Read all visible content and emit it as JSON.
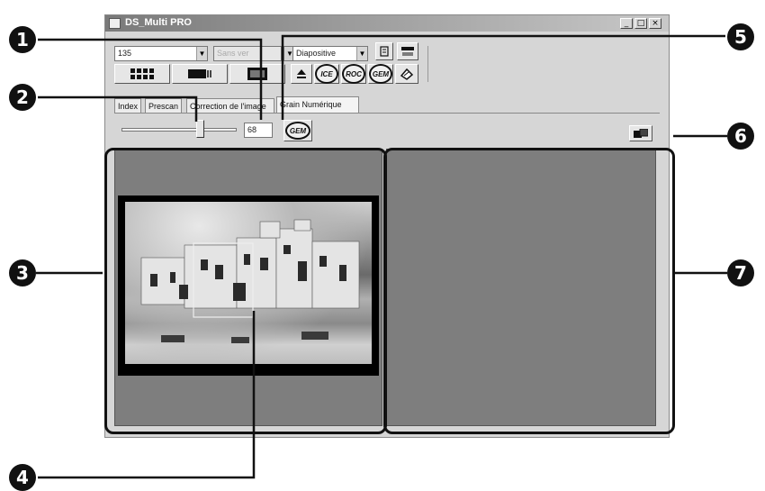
{
  "window": {
    "title": "DS_Multi PRO",
    "controls": [
      "_",
      "□",
      "×"
    ]
  },
  "toolbar": {
    "film_format": "135",
    "film_holder": "Sans ver",
    "film_type": "Diapositive",
    "dropdown_arrow": "▼",
    "row1_icons": [
      "eject-icon",
      "settings-icon"
    ],
    "row2_buttons": [
      "index-scan-icon",
      "prescan-icon",
      "scan-icon"
    ],
    "row2_icons": [
      "eject-icon",
      "ice-icon",
      "roc-icon",
      "gem-icon",
      "tool-icon"
    ],
    "ice_label": "ICE",
    "roc_label": "ROC",
    "gem_label": "GEM"
  },
  "tabs": [
    {
      "label": "Index",
      "active": false
    },
    {
      "label": "Prescan",
      "active": false
    },
    {
      "label": "Correction de l'image",
      "active": false
    },
    {
      "label": "Grain Numérique",
      "active": true
    }
  ],
  "gem": {
    "slider_level_percent": 68,
    "value": "68",
    "apply_label": "GEM"
  },
  "callouts": [
    "1",
    "2",
    "3",
    "4",
    "5",
    "6",
    "7"
  ],
  "colors": {
    "title_bar_start": "#7a7a7a",
    "window_bg": "#d6d6d6",
    "pane_bg": "#7e7e7e",
    "callout": "#111111"
  }
}
